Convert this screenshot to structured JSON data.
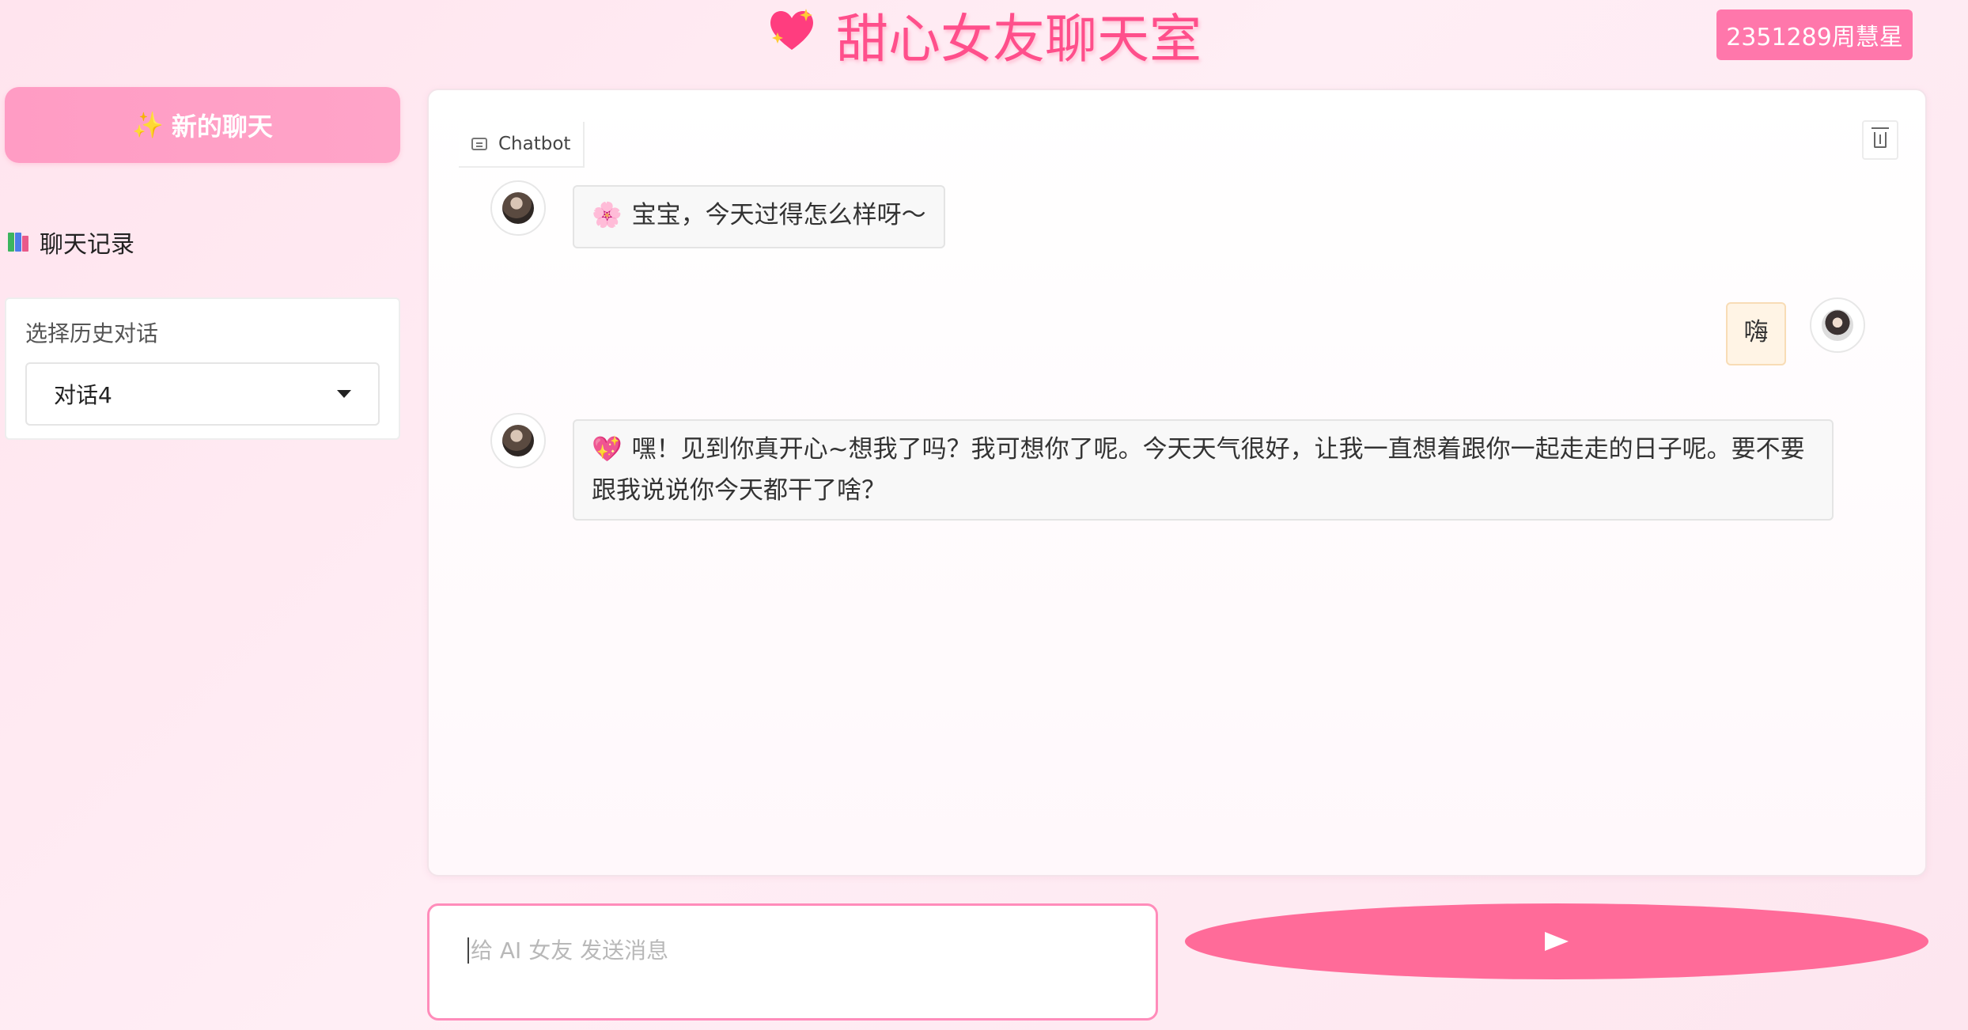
{
  "header": {
    "title": "甜心女友聊天室",
    "user_badge": "2351289周慧星",
    "title_icon": "sparkling-heart-icon"
  },
  "sidebar": {
    "new_chat_label": "新的聊天",
    "new_chat_icon": "✨",
    "history_heading": "聊天记录",
    "history_icon": "books-icon",
    "history_select_label": "选择历史对话",
    "history_selected": "对话4"
  },
  "chat": {
    "panel_label": "Chatbot",
    "messages": [
      {
        "role": "assistant",
        "emoji": "🌸",
        "text": "宝宝，今天过得怎么样呀～"
      },
      {
        "role": "user",
        "text": "嗨"
      },
      {
        "role": "assistant",
        "emoji": "💖",
        "text": "嘿！见到你真开心~想我了吗？我可想你了呢。今天天气很好，让我一直想着跟你一起走走的日子呢。要不要跟我说说你今天都干了啥？"
      }
    ]
  },
  "input": {
    "placeholder": "给 AI 女友 发送消息",
    "value": ""
  },
  "colors": {
    "accent": "#ff6b99",
    "title_pink": "#ff4f8b",
    "badge": "#ff77ab",
    "new_chat_bg": "#ff9cc4"
  }
}
